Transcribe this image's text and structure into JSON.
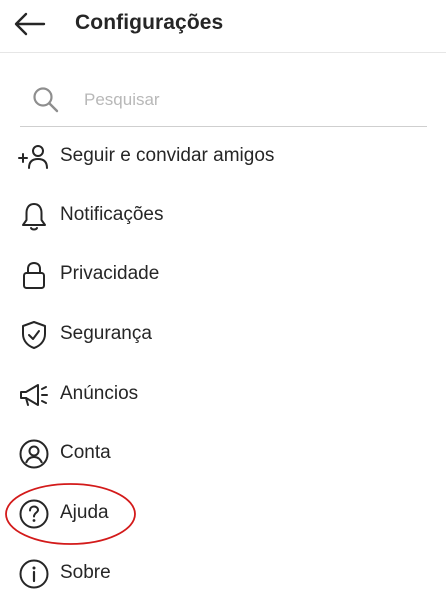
{
  "header": {
    "title": "Configurações"
  },
  "search": {
    "placeholder": "Pesquisar"
  },
  "menu": {
    "items": [
      {
        "label": "Seguir e convidar amigos"
      },
      {
        "label": "Notificações"
      },
      {
        "label": "Privacidade"
      },
      {
        "label": "Segurança"
      },
      {
        "label": "Anúncios"
      },
      {
        "label": "Conta"
      },
      {
        "label": "Ajuda"
      },
      {
        "label": "Sobre"
      }
    ]
  },
  "annotation": {
    "highlight_color": "#d31a1a",
    "highlighted_item": "Ajuda"
  }
}
